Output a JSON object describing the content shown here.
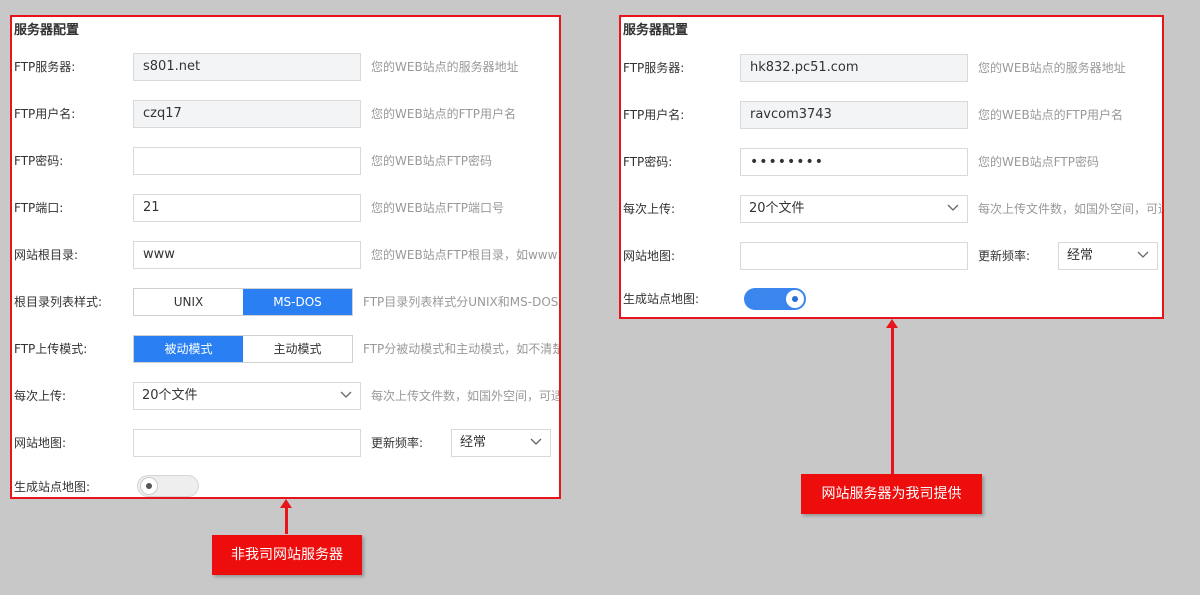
{
  "left_panel": {
    "title": "服务器配置",
    "ftp_server": {
      "label": "FTP服务器:",
      "value": "s801.net",
      "hint": "您的WEB站点的服务器地址"
    },
    "ftp_user": {
      "label": "FTP用户名:",
      "value": "czq17",
      "hint": "您的WEB站点的FTP用户名"
    },
    "ftp_password": {
      "label": "FTP密码:",
      "value": "",
      "hint": "您的WEB站点FTP密码"
    },
    "ftp_port": {
      "label": "FTP端口:",
      "value": "21",
      "hint": "您的WEB站点FTP端口号"
    },
    "site_root": {
      "label": "网站根目录:",
      "value": "www",
      "hint": "您的WEB站点FTP根目录，如www"
    },
    "list_style": {
      "label": "根目录列表样式:",
      "options": [
        "UNIX",
        "MS-DOS"
      ],
      "selected": "MS-DOS",
      "hint": "FTP目录列表样式分UNIX和MS-DOS"
    },
    "ftp_mode": {
      "label": "FTP上传模式:",
      "options": [
        "被动模式",
        "主动模式"
      ],
      "selected": "被动模式",
      "hint": "FTP分被动模式和主动模式，如不清楚"
    },
    "per_upload": {
      "label": "每次上传:",
      "value": "20个文件",
      "hint": "每次上传文件数，如国外空间，可适"
    },
    "sitemap": {
      "label": "网站地图:",
      "value": "",
      "freq_label": "更新频率:",
      "freq_value": "经常"
    },
    "gen_sitemap": {
      "label": "生成站点地图:",
      "enabled": false
    }
  },
  "right_panel": {
    "title": "服务器配置",
    "ftp_server": {
      "label": "FTP服务器:",
      "value": "hk832.pc51.com",
      "hint": "您的WEB站点的服务器地址"
    },
    "ftp_user": {
      "label": "FTP用户名:",
      "value": "ravcom3743",
      "hint": "您的WEB站点的FTP用户名"
    },
    "ftp_password": {
      "label": "FTP密码:",
      "value": "••••••••",
      "hint": "您的WEB站点FTP密码"
    },
    "per_upload": {
      "label": "每次上传:",
      "value": "20个文件",
      "hint": "每次上传文件数，如国外空间，可适"
    },
    "sitemap": {
      "label": "网站地图:",
      "value": "",
      "freq_label": "更新频率:",
      "freq_value": "经常"
    },
    "gen_sitemap": {
      "label": "生成站点地图:",
      "enabled": true
    }
  },
  "callouts": {
    "left": "非我司网站服务器",
    "right": "网站服务器为我司提供"
  },
  "colors": {
    "highlight_border": "#e8141b",
    "callout_bg": "#ee0d0d",
    "accent_blue": "#2a80f2",
    "background": "#c8c8c8"
  }
}
